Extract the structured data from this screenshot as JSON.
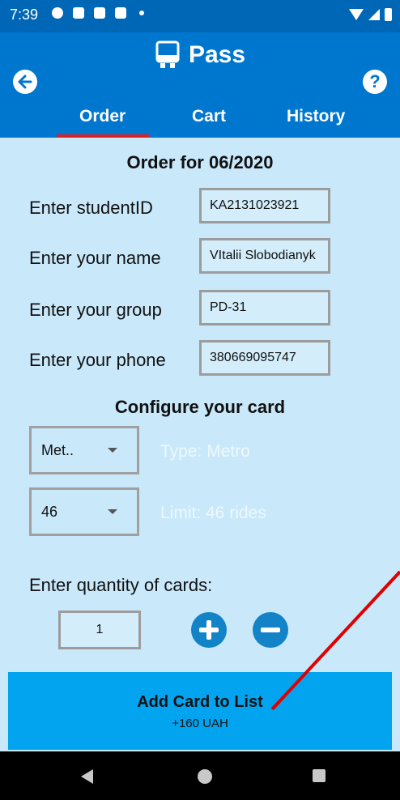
{
  "status_bar": {
    "time": "7:39"
  },
  "app": {
    "title": "Pass",
    "tabs": [
      {
        "label": "Order"
      },
      {
        "label": "Cart"
      },
      {
        "label": "History"
      }
    ],
    "help_label": "?"
  },
  "order": {
    "heading": "Order for 06/2020",
    "fields": [
      {
        "label": "Enter studentID",
        "value": "KA2131023921"
      },
      {
        "label": "Enter your name",
        "value": "VItalii Slobodianyk"
      },
      {
        "label": "Enter your group",
        "value": "PD-31"
      },
      {
        "label": "Enter your phone",
        "value": "380669095747"
      }
    ]
  },
  "card": {
    "heading": "Configure your card",
    "type_select": "Met..",
    "type_hint": "Type: Metro",
    "limit_select": "46",
    "limit_hint": "Limit: 46 rides"
  },
  "quantity": {
    "label": "Enter quantity of cards:",
    "value": "1"
  },
  "add_button": {
    "label": "Add Card to List",
    "price": "+160 UAH"
  },
  "colors": {
    "header": "#0077cf",
    "status_bar": "#0067b6",
    "content_bg": "#c9e9fb",
    "button": "#03a4ef",
    "tab_indicator": "#e02020",
    "annotation_arrow": "#e00000"
  }
}
